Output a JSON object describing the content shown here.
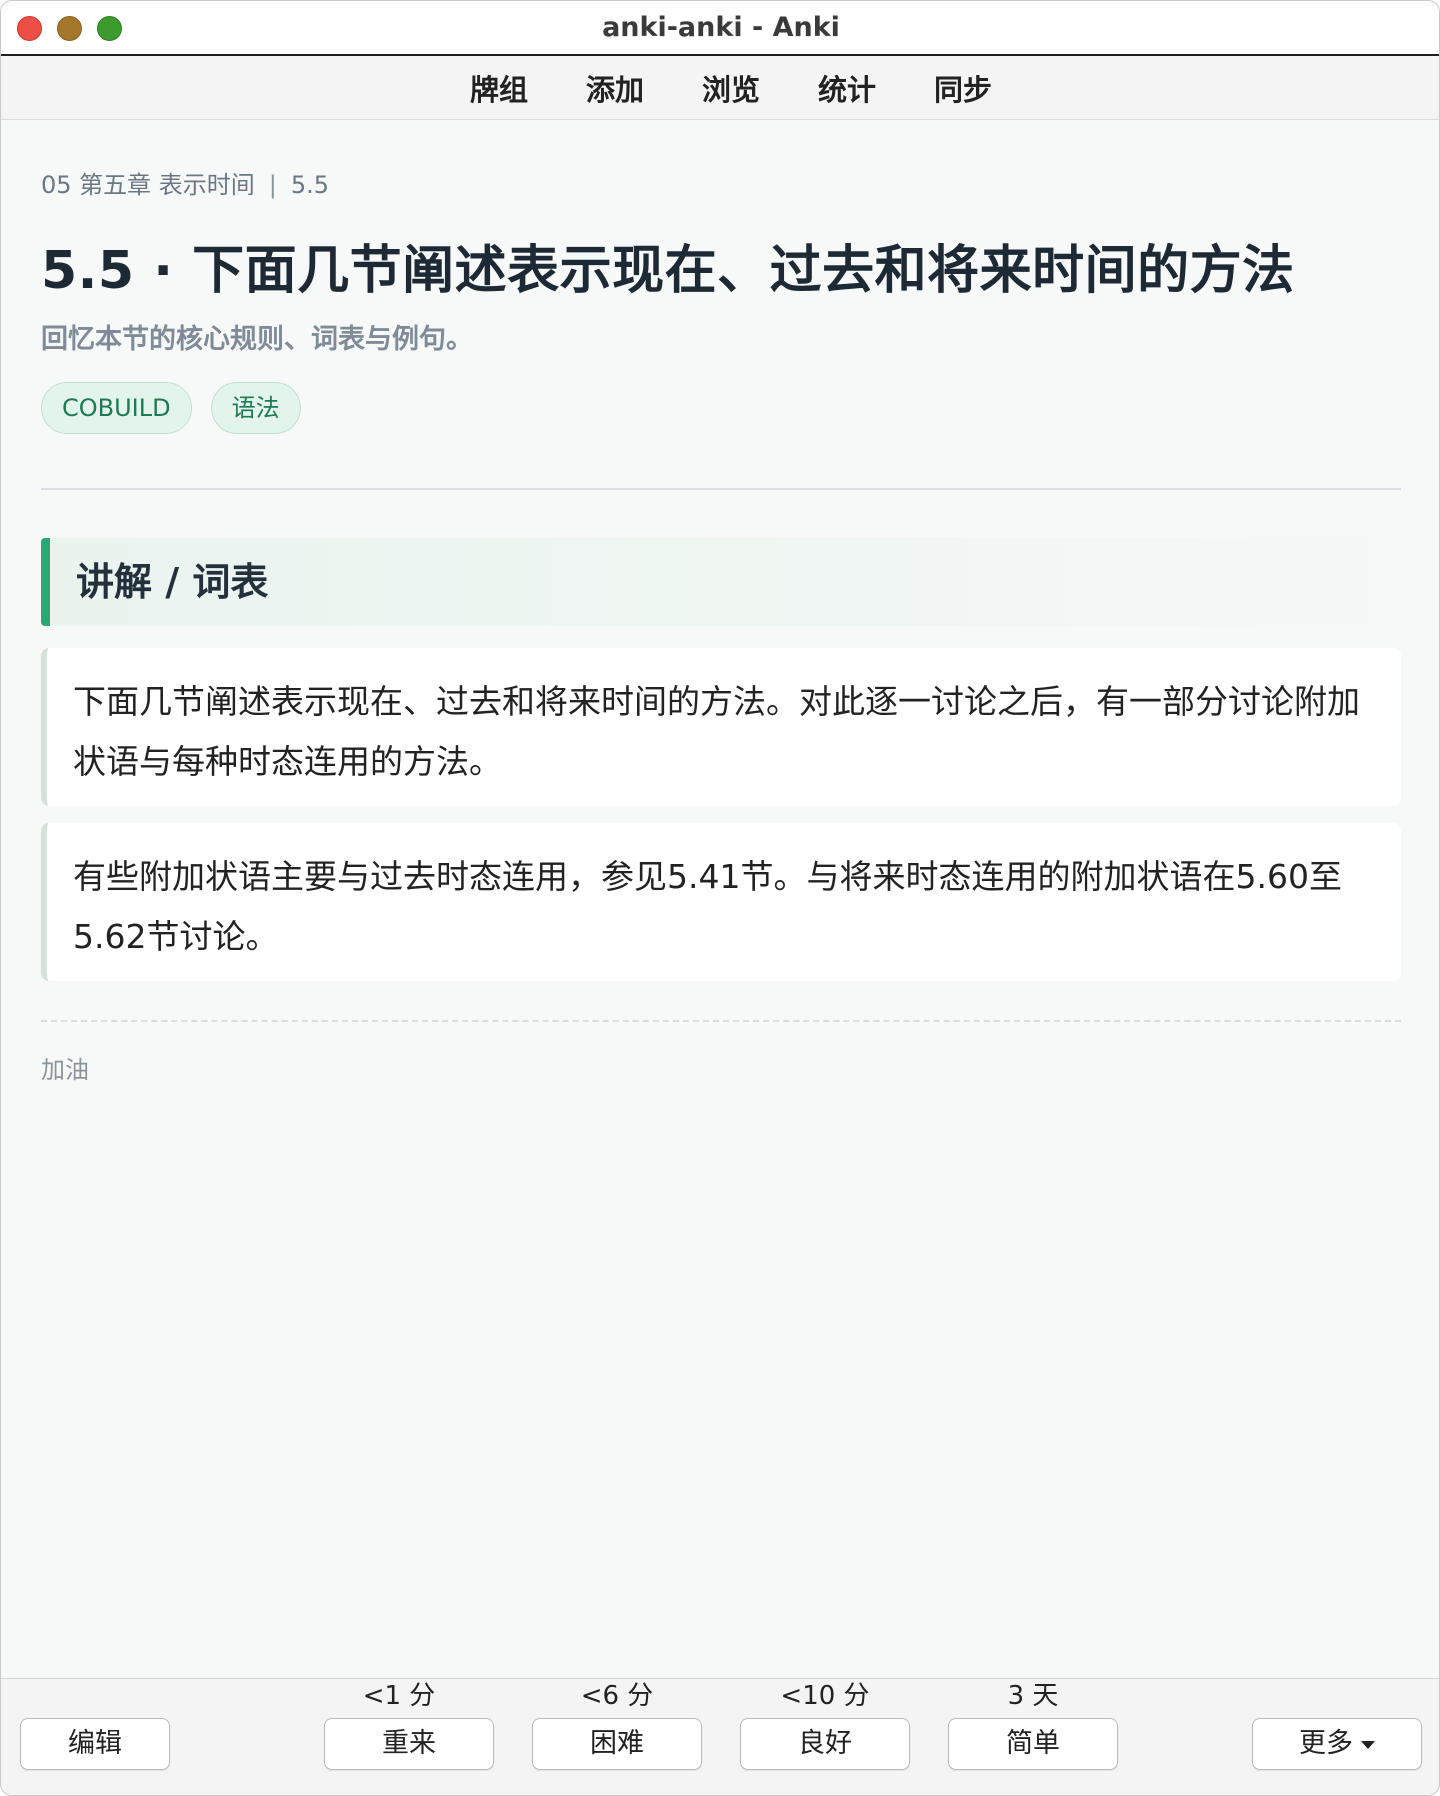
{
  "window": {
    "title": "anki-anki - Anki"
  },
  "toolbar": {
    "items": [
      {
        "label": "牌组"
      },
      {
        "label": "添加"
      },
      {
        "label": "浏览"
      },
      {
        "label": "统计"
      },
      {
        "label": "同步"
      }
    ]
  },
  "card": {
    "breadcrumb": {
      "chapter": "05 第五章 表示时间",
      "separator": "|",
      "section": "5.5"
    },
    "title": "5.5 · 下面几节阐述表示现在、过去和将来时间的方法",
    "subtitle": "回忆本节的核心规则、词表与例句。",
    "tags": [
      "COBUILD",
      "语法"
    ],
    "section_header": "讲解 / 词表",
    "paragraphs": [
      "下面几节阐述表示现在、过去和将来时间的方法。对此逐一讨论之后，有一部分讨论附加状语与每种时态连用的方法。",
      "有些附加状语主要与过去时态连用，参见5.41节。与将来时态连用的附加状语在5.60至5.62节讨论。"
    ],
    "footnote": "加油"
  },
  "bottombar": {
    "edit_label": "编辑",
    "more_label": "更多",
    "answers": [
      {
        "interval": "<1 分",
        "label": "重来"
      },
      {
        "interval": "<6 分",
        "label": "困难"
      },
      {
        "interval": "<10 分",
        "label": "良好"
      },
      {
        "interval": "3 天",
        "label": "简单"
      }
    ]
  },
  "colors": {
    "accent": "#2ba874",
    "tag_text": "#1d7a52",
    "tag_bg": "#e3f4ec",
    "traffic_close": "#ee4f44",
    "traffic_minimize": "#a5772d",
    "traffic_zoom": "#3d9b2d"
  }
}
